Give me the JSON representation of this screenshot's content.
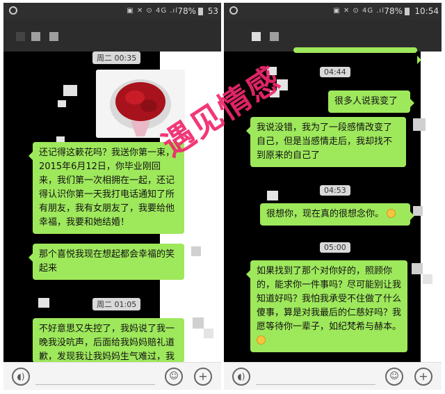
{
  "left": {
    "status": {
      "battery": "78%",
      "time": "53"
    },
    "timestamps": [
      "周二 00:35",
      "周二 01:05"
    ],
    "messages": [
      "还记得这簌花吗？我送你第一束，2015年6月12日，你毕业刚回来，我们第一次相拥在一起，还记得认识你第一天我打电话通知了所有朋友，我有女朋友了，我要给他幸福，我要和她结婚！",
      "那个喜悦我现在想起都会幸福的笑起来",
      "不好意思又失控了，我妈说了我一晚我没吭声，后面给我妈妈赔礼道歉，发现我让我妈妈生气难过，我"
    ]
  },
  "right": {
    "status": {
      "battery": "78%",
      "time": "10:54"
    },
    "timestamps": [
      "04:44",
      "04:53",
      "05:00"
    ],
    "messages": [
      "很多人说我变了",
      "我说没错，我为了一段感情改变了自己，但是当感情走后，我却找不到原来的自己了",
      "很想你，现在真的很想念你。",
      "如果找到了那个对你好的，照顾你的，能求你一件事吗？尽可能别让我知道好吗？我怕我承受不住做了什么傻事，算是对我最后的仁慈好吗？我愿等待你一辈子，如纪梵希与赫本。"
    ]
  },
  "watermark": "遇见情感",
  "icons": [
    "voice-icon",
    "emoji-icon",
    "plus-icon",
    "smile-emoji-icon",
    "bouquet-photo"
  ],
  "colors": {
    "bubble": "#9ee85c",
    "watermark": "#f0286e",
    "titlebar": "#2c2c2c"
  }
}
